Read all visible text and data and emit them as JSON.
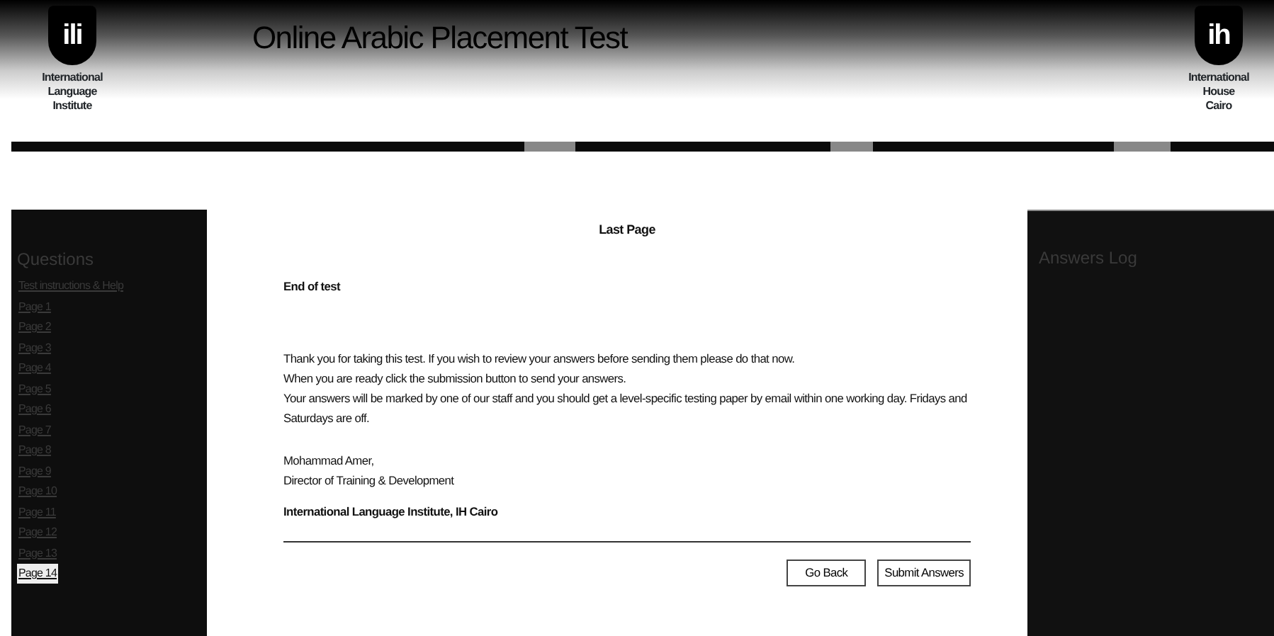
{
  "header": {
    "left_logo": {
      "mark": "ili",
      "caption": [
        "International",
        "Language",
        "Institute"
      ]
    },
    "title": "Online Arabic Placement Test",
    "right_logo": {
      "mark": "ih",
      "caption": [
        "International",
        "House",
        "Cairo"
      ]
    }
  },
  "sidebar": {
    "heading": "Questions",
    "items": [
      {
        "label": "Test instructions & Help",
        "selected": false
      },
      {
        "label": "Page 1",
        "selected": false
      },
      {
        "label": "Page 2",
        "selected": false
      },
      {
        "label": "Page 3",
        "selected": false
      },
      {
        "label": "Page 4",
        "selected": false
      },
      {
        "label": "Page 5",
        "selected": false
      },
      {
        "label": "Page 6",
        "selected": false
      },
      {
        "label": "Page 7",
        "selected": false
      },
      {
        "label": "Page 8",
        "selected": false
      },
      {
        "label": "Page 9",
        "selected": false
      },
      {
        "label": "Page 10",
        "selected": false
      },
      {
        "label": "Page 11",
        "selected": false
      },
      {
        "label": "Page 12",
        "selected": false
      },
      {
        "label": "Page 13",
        "selected": false
      },
      {
        "label": "Page 14",
        "selected": true
      }
    ]
  },
  "main": {
    "page_title": "Last Page",
    "heading": "End of test",
    "paragraph_lines": [
      "Thank you for taking this test. If you wish to review your answers before sending them please do that now.",
      "When you are ready click the submission button to send your answers.",
      "Your answers will be marked by one of our staff and you should get a level-specific testing paper by email within one working day. Fridays and Saturdays are off."
    ],
    "signature": [
      "Mohammad Amer,",
      "Director of Training & Development"
    ],
    "organization": "International Language Institute, IH Cairo",
    "buttons": [
      "Go Back",
      "Submit Answers"
    ]
  },
  "answers_panel": {
    "heading": "Answers Log"
  }
}
